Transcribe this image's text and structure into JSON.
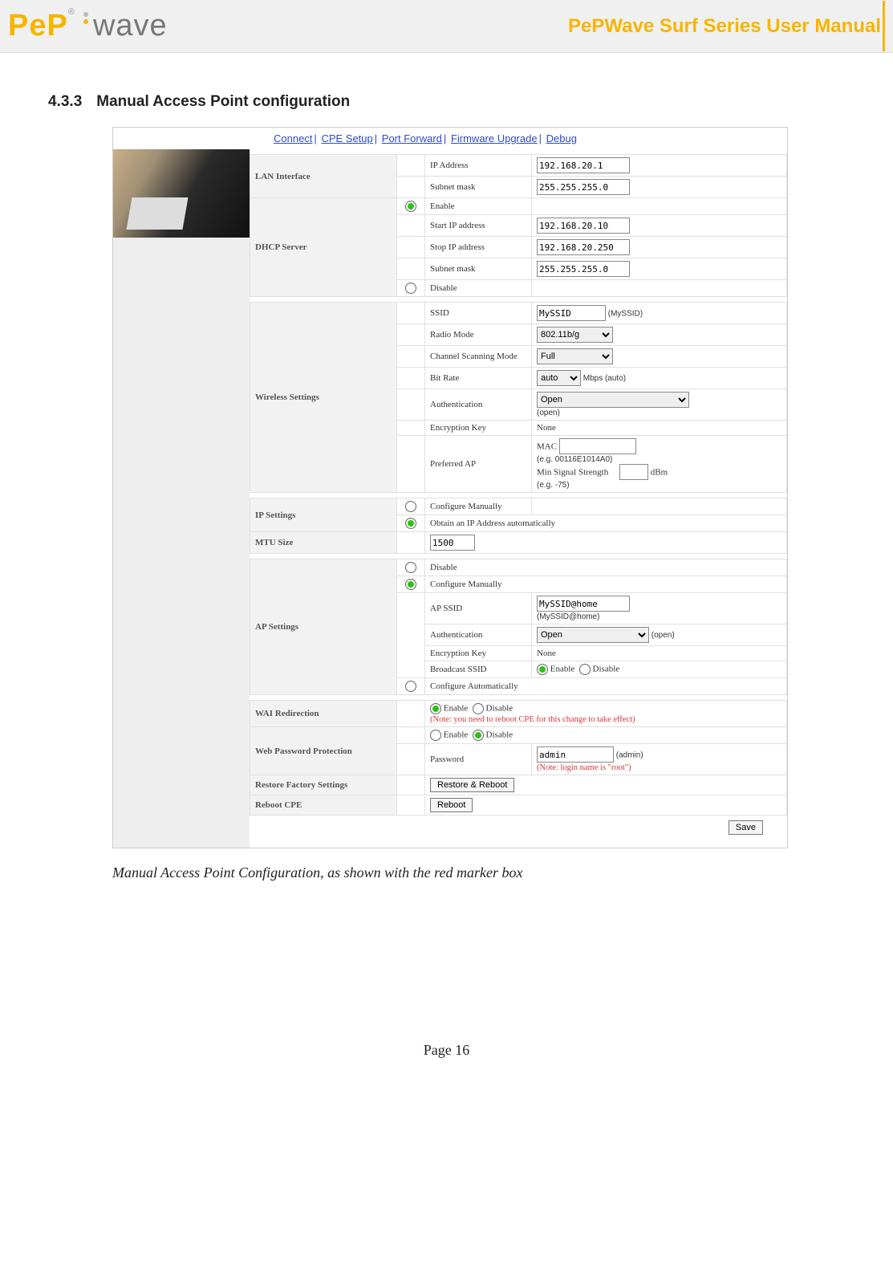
{
  "header": {
    "brand_pep": "PeP",
    "brand_wave": "wave",
    "title": "PePWave Surf Series User Manual"
  },
  "section": {
    "number": "4.3.3",
    "title": "Manual Access Point configuration"
  },
  "nav": {
    "items": [
      "Connect",
      "CPE Setup",
      "Port Forward",
      "Firmware Upgrade",
      "Debug"
    ]
  },
  "lan": {
    "section": "LAN Interface",
    "ip_lbl": "IP Address",
    "ip": "192.168.20.1",
    "mask_lbl": "Subnet mask",
    "mask": "255.255.255.0"
  },
  "dhcp": {
    "section": "DHCP Server",
    "enable": "Enable",
    "disable": "Disable",
    "start_lbl": "Start IP address",
    "start": "192.168.20.10",
    "stop_lbl": "Stop IP address",
    "stop": "192.168.20.250",
    "mask_lbl": "Subnet mask",
    "mask": "255.255.255.0"
  },
  "wifi": {
    "section": "Wireless Settings",
    "ssid_lbl": "SSID",
    "ssid": "MySSID",
    "ssid_hint": "(MySSID)",
    "mode_lbl": "Radio Mode",
    "mode": "802.11b/g",
    "scan_lbl": "Channel Scanning Mode",
    "scan": "Full",
    "rate_lbl": "Bit Rate",
    "rate": "auto",
    "rate_hint": "Mbps (auto)",
    "auth_lbl": "Authentication",
    "auth": "Open",
    "auth_hint": "(open)",
    "enc_lbl": "Encryption Key",
    "enc": "None",
    "pref_lbl": "Preferred AP",
    "mac_lbl": "MAC",
    "mac_hint": "(e.g. 00116E1014A0)",
    "rssi_lbl": "Min Signal Strength",
    "rssi_unit": "dBm",
    "rssi_hint": "(e.g. -75)"
  },
  "ip": {
    "section": "IP Settings",
    "manual": "Configure Manually",
    "auto": "Obtain an IP Address automatically"
  },
  "mtu": {
    "section": "MTU Size",
    "val": "1500"
  },
  "ap": {
    "section": "AP Settings",
    "disable": "Disable",
    "manual": "Configure Manually",
    "auto": "Configure Automatically",
    "ssid_lbl": "AP SSID",
    "ssid": "MySSID@home",
    "ssid_hint": "(MySSID@home)",
    "auth_lbl": "Authentication",
    "auth": "Open",
    "auth_hint": "(open)",
    "enc_lbl": "Encryption Key",
    "enc": "None",
    "bcast_lbl": "Broadcast SSID",
    "bcast_en": "Enable",
    "bcast_dis": "Disable"
  },
  "wai": {
    "section": "WAI Redirection",
    "en": "Enable",
    "dis": "Disable",
    "note": "(Note: you need to reboot CPE for this change to take effect)"
  },
  "pw": {
    "section": "Web Password Protection",
    "en": "Enable",
    "dis": "Disable",
    "pw_lbl": "Password",
    "pw": "admin",
    "pw_hint": "(admin)",
    "note": "(Note: login name is \"root\")"
  },
  "rfs": {
    "section": "Restore Factory Settings",
    "btn": "Restore & Reboot"
  },
  "rb": {
    "section": "Reboot CPE",
    "btn": "Reboot"
  },
  "save": "Save",
  "caption": "Manual Access Point Configuration, as shown with the red marker box",
  "footer": "Page 16"
}
